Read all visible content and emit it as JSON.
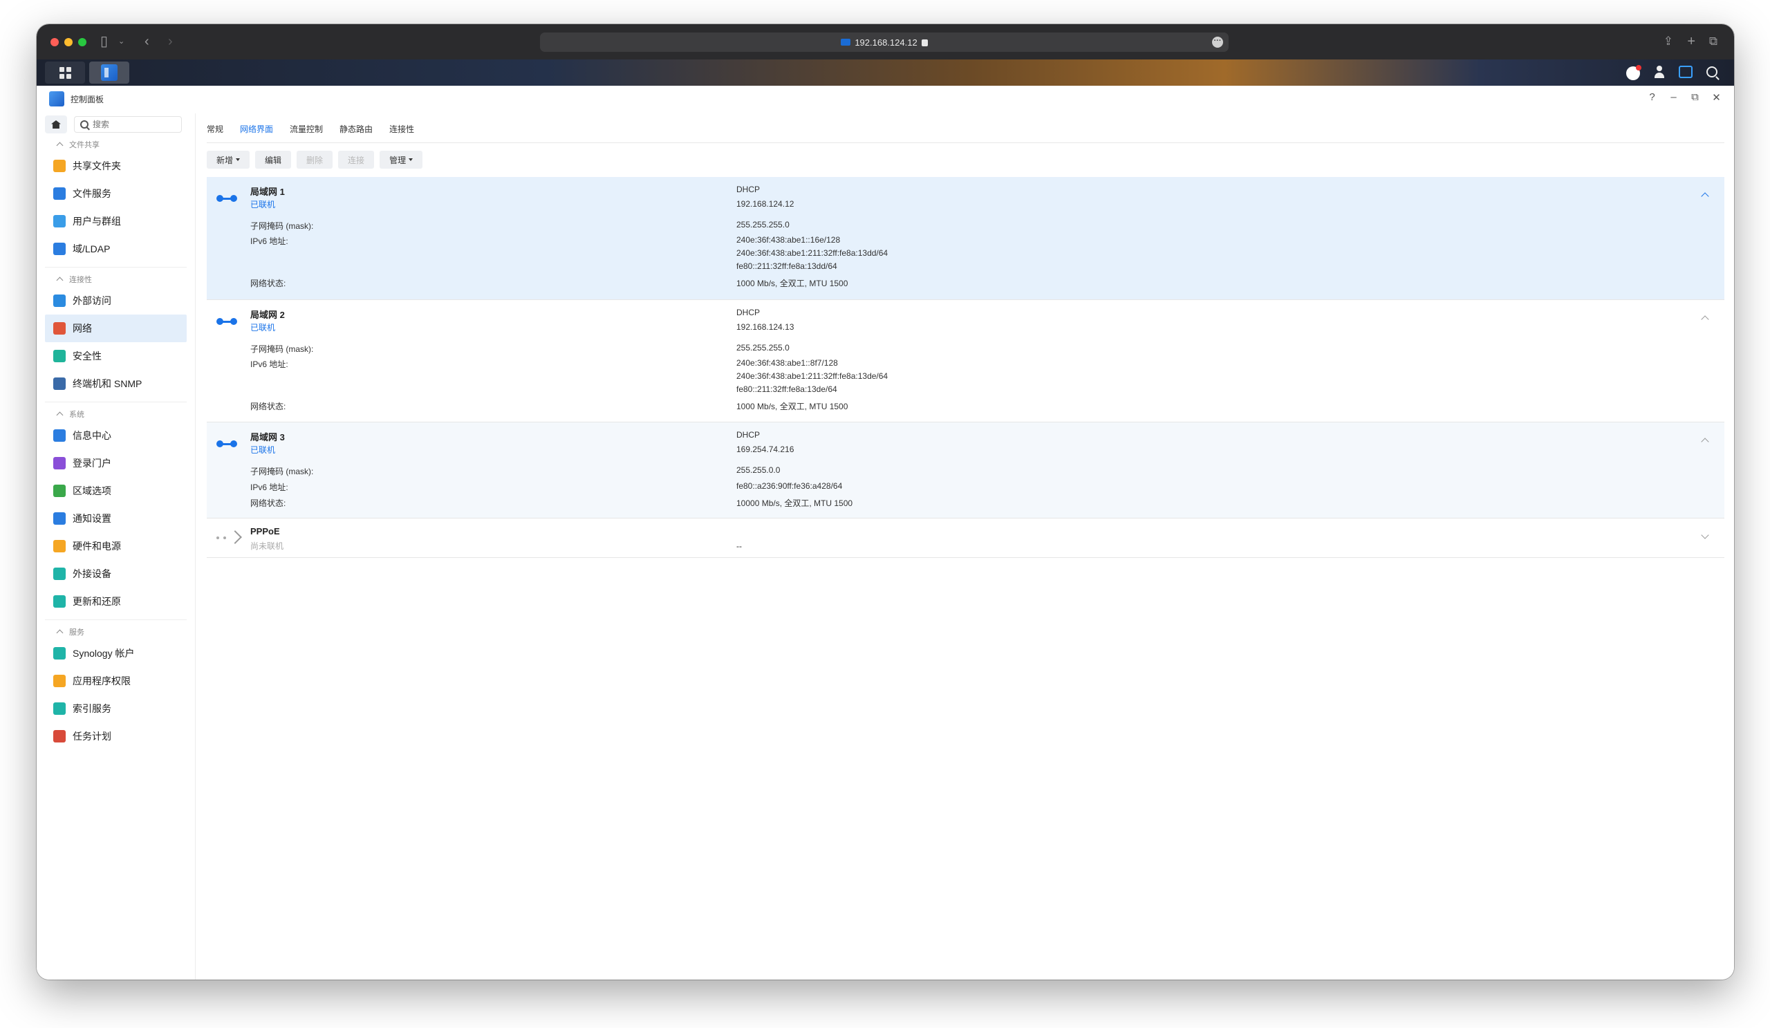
{
  "browser": {
    "address": "192.168.124.12"
  },
  "window": {
    "title": "控制面板",
    "controls": [
      "?",
      "–",
      "⧉",
      "✕"
    ]
  },
  "sidebar": {
    "search_placeholder": "搜索",
    "sections": [
      {
        "title": "文件共享",
        "items": [
          {
            "label": "共享文件夹",
            "icon": "folder-share-icon",
            "color": "#f5a623"
          },
          {
            "label": "文件服务",
            "icon": "file-service-icon",
            "color": "#2b7de0"
          },
          {
            "label": "用户与群组",
            "icon": "users-icon",
            "color": "#3a9de8"
          },
          {
            "label": "域/LDAP",
            "icon": "ldap-icon",
            "color": "#2b7de0"
          }
        ]
      },
      {
        "title": "连接性",
        "items": [
          {
            "label": "外部访问",
            "icon": "external-access-icon",
            "color": "#2b8be0"
          },
          {
            "label": "网络",
            "icon": "network-icon",
            "color": "#e0563a",
            "active": true
          },
          {
            "label": "安全性",
            "icon": "security-shield-icon",
            "color": "#1fb49a"
          },
          {
            "label": "终端机和 SNMP",
            "icon": "terminal-icon",
            "color": "#3a6aa8"
          }
        ]
      },
      {
        "title": "系统",
        "items": [
          {
            "label": "信息中心",
            "icon": "info-icon",
            "color": "#2b7de0"
          },
          {
            "label": "登录门户",
            "icon": "login-portal-icon",
            "color": "#8a4fd8"
          },
          {
            "label": "区域选项",
            "icon": "region-icon",
            "color": "#3aa84a"
          },
          {
            "label": "通知设置",
            "icon": "notification-icon",
            "color": "#2b7de0"
          },
          {
            "label": "硬件和电源",
            "icon": "hardware-power-icon",
            "color": "#f5a623"
          },
          {
            "label": "外接设备",
            "icon": "external-device-icon",
            "color": "#1fb4a8"
          },
          {
            "label": "更新和还原",
            "icon": "update-restore-icon",
            "color": "#1fb4a8"
          }
        ]
      },
      {
        "title": "服务",
        "items": [
          {
            "label": "Synology 帐户",
            "icon": "synology-account-icon",
            "color": "#1fb4a8"
          },
          {
            "label": "应用程序权限",
            "icon": "app-privilege-icon",
            "color": "#f5a623"
          },
          {
            "label": "索引服务",
            "icon": "index-service-icon",
            "color": "#1fb4a8"
          },
          {
            "label": "任务计划",
            "icon": "task-scheduler-icon",
            "color": "#d84a3a"
          }
        ]
      }
    ]
  },
  "tabs": [
    {
      "label": "常规",
      "active": false
    },
    {
      "label": "网络界面",
      "active": true
    },
    {
      "label": "流量控制",
      "active": false
    },
    {
      "label": "静态路由",
      "active": false
    },
    {
      "label": "连接性",
      "active": false
    }
  ],
  "toolbar": {
    "create": "新增",
    "edit": "编辑",
    "delete": "删除",
    "connect": "连接",
    "manage": "管理"
  },
  "labels": {
    "mask": "子网掩码 (mask):",
    "ipv6": "IPv6 地址:",
    "net_status": "网络状态:"
  },
  "interfaces": [
    {
      "name": "局域网 1",
      "status": "已联机",
      "mode": "DHCP",
      "ip": "192.168.124.12",
      "mask": "255.255.255.0",
      "ipv6": [
        "240e:36f:438:abe1::16e/128",
        "240e:36f:438:abe1:211:32ff:fe8a:13dd/64",
        "fe80::211:32ff:fe8a:13dd/64"
      ],
      "net_status": "1000 Mb/s, 全双工, MTU 1500"
    },
    {
      "name": "局域网 2",
      "status": "已联机",
      "mode": "DHCP",
      "ip": "192.168.124.13",
      "mask": "255.255.255.0",
      "ipv6": [
        "240e:36f:438:abe1::8f7/128",
        "240e:36f:438:abe1:211:32ff:fe8a:13de/64",
        "fe80::211:32ff:fe8a:13de/64"
      ],
      "net_status": "1000 Mb/s, 全双工, MTU 1500"
    },
    {
      "name": "局域网 3",
      "status": "已联机",
      "mode": "DHCP",
      "ip": "169.254.74.216",
      "mask": "255.255.0.0",
      "ipv6": [
        "fe80::a236:90ff:fe36:a428/64"
      ],
      "net_status": "10000 Mb/s, 全双工, MTU 1500"
    },
    {
      "name": "PPPoE",
      "status": "尚未联机",
      "value": "--"
    }
  ]
}
